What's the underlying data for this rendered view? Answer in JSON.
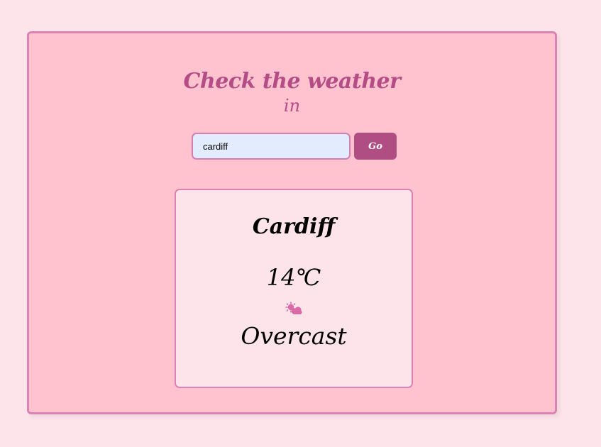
{
  "header": {
    "title": "Check the weather",
    "subtitle": "in"
  },
  "search": {
    "value": "cardiff",
    "button_label": "Go"
  },
  "weather": {
    "city": "Cardiff",
    "temperature": "14℃",
    "icon": "sun-behind-cloud-icon",
    "condition": "Overcast"
  },
  "colors": {
    "background": "#fde4ea",
    "card": "#ffc2cf",
    "accent": "#b04e84",
    "border": "#dd82b4",
    "input_bg": "#e3ecfd"
  }
}
